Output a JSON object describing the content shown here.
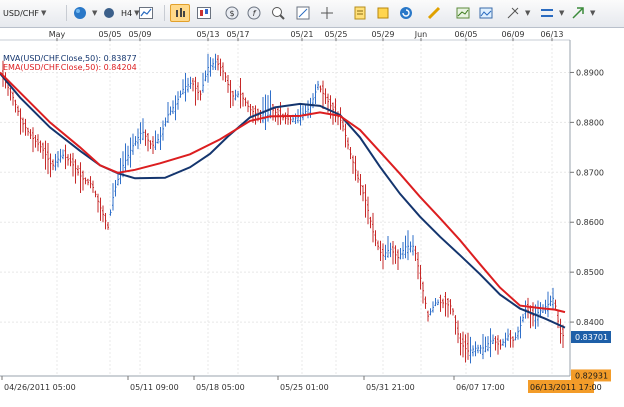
{
  "toolbar": {
    "symbol": "USD/CHF",
    "timeframe": "H4",
    "icons": [
      "dropdown-chevron",
      "globe-icon",
      "grid-icon",
      "timeframe-dropdown",
      "line-chart-icon",
      "bar-chart-icon",
      "candlestick-chart-icon",
      "price-alert-icon",
      "indicator-f-icon",
      "zoom-in-icon",
      "zoom-out-icon",
      "crosshair-icon",
      "refresh-icon",
      "note-icon",
      "alert-bell-icon",
      "trendline-pencil-icon",
      "chart-type-icon",
      "save-image-icon",
      "fibonacci-icon",
      "layout-icon",
      "arrow-tool-icon"
    ]
  },
  "legend": {
    "mva": "MVA(USD/CHF.Close,50): 0.83877",
    "ema": "EMA(USD/CHF.Close,50): 0.84204"
  },
  "colors": {
    "mva": "#14356e",
    "ema": "#dc1e20",
    "up": "#2f6fc9",
    "down": "#c62828",
    "price_badge": "#1e5fa8",
    "date_badge": "#f39c29"
  },
  "top_axis_labels": [
    "May",
    "05/05",
    "05/09",
    "05/13",
    "05/17",
    "05/21",
    "05/25",
    "05/29",
    "Jun",
    "06/05",
    "06/09",
    "06/13"
  ],
  "bottom_axis_labels": [
    "04/26/2011 05:00",
    "05/11 09:00",
    "05/18 05:00",
    "05/25 01:00",
    "05/31 21:00",
    "06/07 17:00"
  ],
  "current_date_label": "06/13/2011 17:00",
  "current_price": "0.83701",
  "low_price": "0.82931",
  "chart_data": {
    "type": "line",
    "title": "",
    "symbol": "USD/CHF",
    "timeframe": "H4",
    "price_axis_ticks": [
      "0.8900",
      "0.8800",
      "0.8700",
      "0.8600",
      "0.8500",
      "0.8400"
    ],
    "ylim": [
      0.8292,
      0.8965
    ],
    "series": [
      {
        "name": "MVA(USD/CHF.Close,50)",
        "last_value": 0.83877,
        "points": [
          [
            0,
            0.8898
          ],
          [
            20,
            0.885
          ],
          [
            50,
            0.879
          ],
          [
            80,
            0.8743
          ],
          [
            100,
            0.8714
          ],
          [
            118,
            0.8698
          ],
          [
            135,
            0.8688
          ],
          [
            165,
            0.8689
          ],
          [
            190,
            0.871
          ],
          [
            210,
            0.8737
          ],
          [
            228,
            0.8772
          ],
          [
            250,
            0.881
          ],
          [
            275,
            0.883
          ],
          [
            300,
            0.8837
          ],
          [
            320,
            0.8833
          ],
          [
            340,
            0.8815
          ],
          [
            360,
            0.877
          ],
          [
            380,
            0.8711
          ],
          [
            400,
            0.8657
          ],
          [
            420,
            0.8611
          ],
          [
            440,
            0.8571
          ],
          [
            460,
            0.8534
          ],
          [
            480,
            0.8496
          ],
          [
            500,
            0.8455
          ],
          [
            520,
            0.8427
          ],
          [
            545,
            0.8407
          ],
          [
            565,
            0.8389
          ]
        ]
      },
      {
        "name": "EMA(USD/CHF.Close,50)",
        "last_value": 0.84204,
        "points": [
          [
            0,
            0.89
          ],
          [
            20,
            0.886
          ],
          [
            50,
            0.88
          ],
          [
            80,
            0.875
          ],
          [
            100,
            0.8714
          ],
          [
            118,
            0.8699
          ],
          [
            135,
            0.8705
          ],
          [
            160,
            0.8718
          ],
          [
            190,
            0.8736
          ],
          [
            220,
            0.8766
          ],
          [
            250,
            0.8803
          ],
          [
            270,
            0.8812
          ],
          [
            300,
            0.8813
          ],
          [
            320,
            0.882
          ],
          [
            340,
            0.8813
          ],
          [
            360,
            0.8785
          ],
          [
            380,
            0.8741
          ],
          [
            400,
            0.8697
          ],
          [
            420,
            0.8651
          ],
          [
            440,
            0.8608
          ],
          [
            460,
            0.8564
          ],
          [
            480,
            0.8516
          ],
          [
            500,
            0.8469
          ],
          [
            520,
            0.8433
          ],
          [
            540,
            0.8428
          ],
          [
            555,
            0.8425
          ],
          [
            565,
            0.842
          ]
        ]
      }
    ],
    "price_path": [
      [
        0,
        0.89
      ],
      [
        12,
        0.8855
      ],
      [
        22,
        0.88
      ],
      [
        32,
        0.877
      ],
      [
        42,
        0.8748
      ],
      [
        52,
        0.8712
      ],
      [
        62,
        0.8736
      ],
      [
        72,
        0.8718
      ],
      [
        82,
        0.8688
      ],
      [
        92,
        0.8675
      ],
      [
        100,
        0.8631
      ],
      [
        108,
        0.859
      ],
      [
        114,
        0.8661
      ],
      [
        122,
        0.871
      ],
      [
        132,
        0.875
      ],
      [
        142,
        0.8783
      ],
      [
        152,
        0.8752
      ],
      [
        160,
        0.877
      ],
      [
        168,
        0.8815
      ],
      [
        176,
        0.8838
      ],
      [
        184,
        0.887
      ],
      [
        192,
        0.888
      ],
      [
        200,
        0.8853
      ],
      [
        208,
        0.891
      ],
      [
        216,
        0.8922
      ],
      [
        224,
        0.89
      ],
      [
        232,
        0.8852
      ],
      [
        240,
        0.8858
      ],
      [
        250,
        0.8826
      ],
      [
        260,
        0.8812
      ],
      [
        270,
        0.883
      ],
      [
        280,
        0.8812
      ],
      [
        290,
        0.8805
      ],
      [
        300,
        0.8812
      ],
      [
        310,
        0.883
      ],
      [
        318,
        0.8875
      ],
      [
        326,
        0.8848
      ],
      [
        334,
        0.8822
      ],
      [
        342,
        0.88
      ],
      [
        350,
        0.874
      ],
      [
        358,
        0.8688
      ],
      [
        366,
        0.8641
      ],
      [
        374,
        0.8572
      ],
      [
        382,
        0.8532
      ],
      [
        390,
        0.8547
      ],
      [
        398,
        0.8529
      ],
      [
        406,
        0.8552
      ],
      [
        414,
        0.8552
      ],
      [
        422,
        0.8473
      ],
      [
        428,
        0.8412
      ],
      [
        436,
        0.844
      ],
      [
        444,
        0.8438
      ],
      [
        452,
        0.8431
      ],
      [
        460,
        0.8358
      ],
      [
        468,
        0.8342
      ],
      [
        476,
        0.8348
      ],
      [
        484,
        0.8348
      ],
      [
        492,
        0.8365
      ],
      [
        500,
        0.8353
      ],
      [
        508,
        0.8372
      ],
      [
        514,
        0.8362
      ],
      [
        520,
        0.839
      ],
      [
        526,
        0.8428
      ],
      [
        532,
        0.8412
      ],
      [
        540,
        0.8422
      ],
      [
        548,
        0.8435
      ],
      [
        554,
        0.845
      ],
      [
        560,
        0.8378
      ],
      [
        565,
        0.837
      ]
    ]
  }
}
